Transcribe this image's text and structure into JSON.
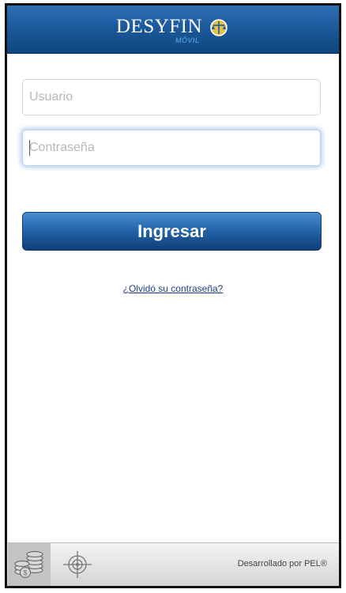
{
  "header": {
    "logo_text": "DESYFIN",
    "logo_sub": "MÓVIL",
    "logo_emblem": "balance-scale-emblem"
  },
  "login_form": {
    "username_placeholder": "Usuario",
    "username_value": "",
    "password_placeholder": "Contraseña",
    "password_value": "",
    "submit_label": "Ingresar",
    "forgot_password_label": "¿Olvidó su contraseña?"
  },
  "footer": {
    "tabs": [
      {
        "icon": "coins-icon",
        "active": true
      },
      {
        "icon": "target-crosshair-icon",
        "active": false
      }
    ],
    "credit": "Desarrollado por PEL®"
  },
  "colors": {
    "header_blue": "#1c5a9c",
    "button_blue": "#2466aa",
    "link_blue": "#1d3f86",
    "logo_sub_blue": "#5ab0f0"
  }
}
